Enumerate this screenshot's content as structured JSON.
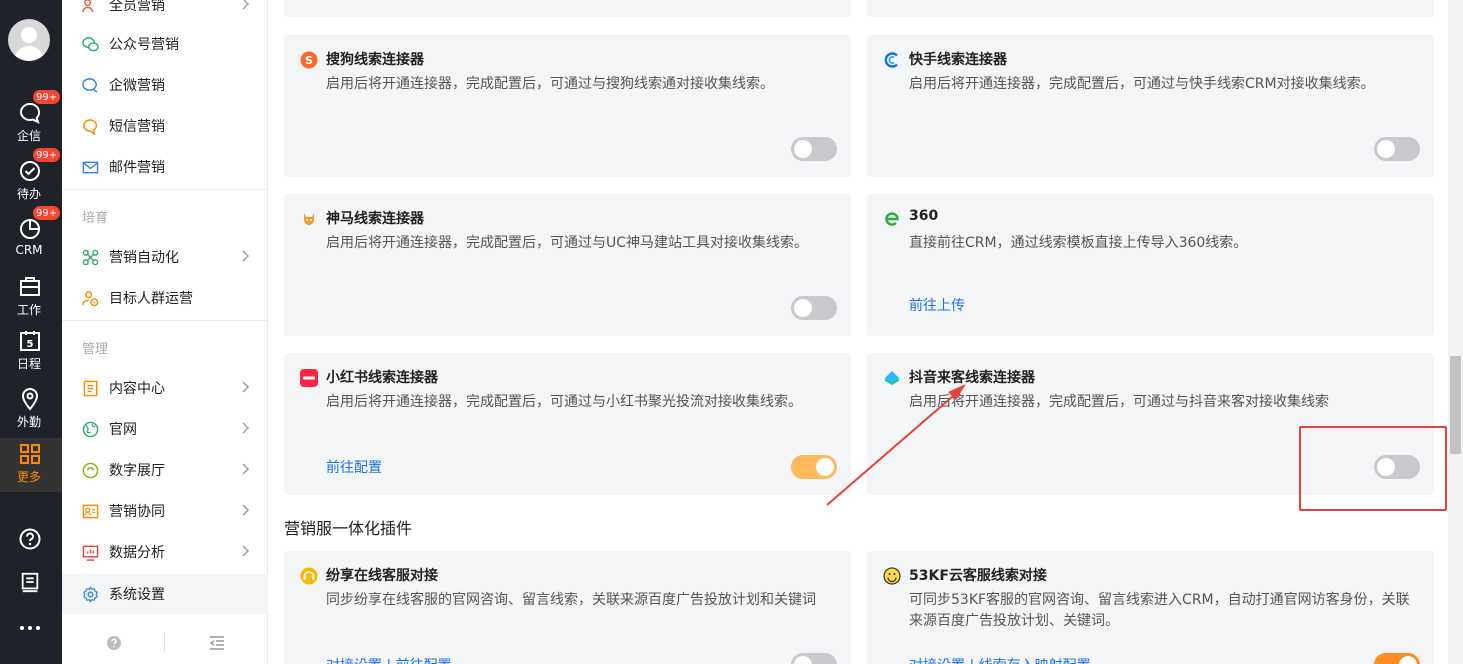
{
  "rail": {
    "items": [
      {
        "label": "企信",
        "badge": "99+",
        "icon": "chat-bubble-icon"
      },
      {
        "label": "待办",
        "badge": "99+",
        "icon": "check-circle-icon"
      },
      {
        "label": "CRM",
        "badge": "99+",
        "icon": "pie-chart-icon"
      },
      {
        "label": "工作",
        "icon": "briefcase-icon"
      },
      {
        "label": "日程",
        "icon": "calendar-icon",
        "day": "5"
      },
      {
        "label": "外勤",
        "icon": "location-pin-icon"
      },
      {
        "label": "更多",
        "icon": "grid-icon",
        "active": true
      }
    ],
    "bottom": [
      "help-icon",
      "report-icon",
      "more-dots-icon"
    ]
  },
  "sidebar": {
    "items_top": [
      {
        "label": "全员营销",
        "icon": "people-icon",
        "arrow": true
      },
      {
        "label": "公众号营销",
        "icon": "wechat-icon"
      },
      {
        "label": "企微营销",
        "icon": "wecom-icon"
      },
      {
        "label": "短信营销",
        "icon": "sms-bubble-icon"
      },
      {
        "label": "邮件营销",
        "icon": "mail-icon"
      }
    ],
    "group_nurture": "培育",
    "items_nurture": [
      {
        "label": "营销自动化",
        "icon": "automation-icon",
        "arrow": true
      },
      {
        "label": "目标人群运营",
        "icon": "target-crowd-icon"
      }
    ],
    "group_manage": "管理",
    "items_manage": [
      {
        "label": "内容中心",
        "icon": "content-doc-icon",
        "arrow": true
      },
      {
        "label": "官网",
        "icon": "globe-icon",
        "arrow": true
      },
      {
        "label": "数字展厅",
        "icon": "showroom-icon",
        "arrow": true
      },
      {
        "label": "营销协同",
        "icon": "collab-card-icon",
        "arrow": true
      },
      {
        "label": "数据分析",
        "icon": "analytics-icon",
        "arrow": true
      },
      {
        "label": "系统设置",
        "icon": "gear-icon",
        "active": true
      }
    ]
  },
  "connectors": [
    {
      "title": "搜狗线索连接器",
      "desc": "启用后将开通连接器，完成配置后，可通过与搜狗线索通对接收集线索。",
      "toggle": "off",
      "icon": "sogou-icon"
    },
    {
      "title": "快手线索连接器",
      "desc": "启用后将开通连接器，完成配置后，可通过与快手线索CRM对接收集线索。",
      "toggle": "off",
      "icon": "kuaishou-icon"
    },
    {
      "title": "神马线索连接器",
      "desc": "启用后将开通连接器，完成配置后，可通过与UC神马建站工具对接收集线索。",
      "toggle": "off",
      "icon": "shenma-icon"
    },
    {
      "title": "360",
      "desc": "直接前往CRM，通过线索模板直接上传导入360线索。",
      "link": "前往上传",
      "icon": "360-browser-icon"
    },
    {
      "title": "小红书线索连接器",
      "desc": "启用后将开通连接器，完成配置后，可通过与小红书聚光投流对接收集线索。",
      "link": "前往配置",
      "toggle": "on",
      "icon": "xiaohongshu-icon"
    },
    {
      "title": "抖音来客线索连接器",
      "desc": "启用后将开通连接器，完成配置后，可通过与抖音来客对接收集线索",
      "toggle": "off",
      "icon": "douyin-laike-icon"
    }
  ],
  "section_plugins": "营销服一体化插件",
  "plugins": [
    {
      "title": "纷享在线客服对接",
      "desc": "同步纷享在线客服的官网咨询、留言线索，关联来源百度广告投放计划和关键词",
      "link": "对接设置 | 前往配置",
      "toggle": "off",
      "icon": "online-service-icon"
    },
    {
      "title": "53KF云客服线索对接",
      "desc": "可同步53KF客服的官网咨询、留言线索进入CRM，自动打通官网访客身份，关联来源百度广告投放计划、关键词。",
      "link": "对接设置 | 线索存入映射配置",
      "toggle": "on",
      "icon": "53kf-smile-icon"
    }
  ],
  "colors": {
    "accent": "#ff8a00",
    "link": "#1a73e8",
    "annotation": "#e8403a",
    "toggle_on": "#ffb85c",
    "toggle_off": "#c7c9cd"
  }
}
